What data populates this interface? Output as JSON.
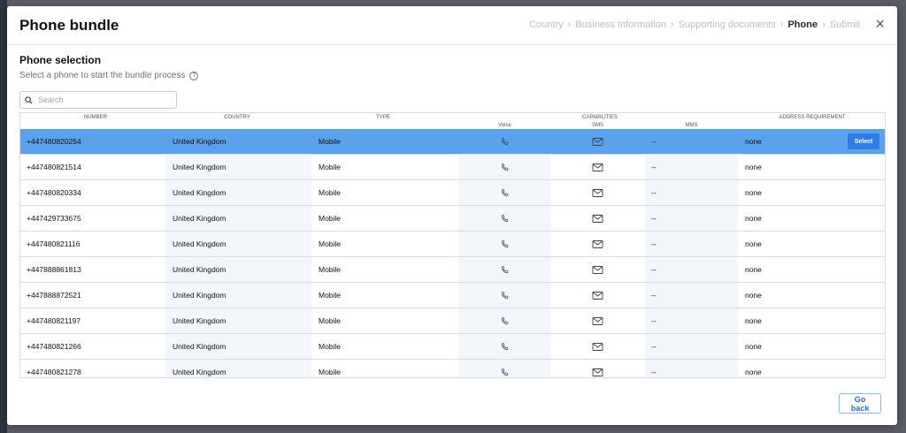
{
  "modal": {
    "title": "Phone bundle",
    "close_icon": "×"
  },
  "breadcrumb": [
    {
      "label": "Country",
      "active": false
    },
    {
      "label": "Business Information",
      "active": false
    },
    {
      "label": "Supporting documents",
      "active": false
    },
    {
      "label": "Phone",
      "active": true
    },
    {
      "label": "Submit",
      "active": false
    }
  ],
  "section": {
    "title": "Phone selection",
    "subtitle": "Select a phone to start the bundle process",
    "help_glyph": "?"
  },
  "search": {
    "placeholder": "Search",
    "value": ""
  },
  "table": {
    "headers": {
      "number": "NUMBER",
      "country": "COUNTRY",
      "type": "TYPE",
      "capabilities": "CAPABILITIES",
      "voice": "Voice",
      "sms": "SMS",
      "mms": "MMS",
      "address": "ADDRESS REQUIREMENT"
    },
    "rows": [
      {
        "number": "+447480820254",
        "country": "United Kingdom",
        "type": "Mobile",
        "mms": "--",
        "address": "none",
        "selected": true
      },
      {
        "number": "+447480821514",
        "country": "United Kingdom",
        "type": "Mobile",
        "mms": "--",
        "address": "none",
        "selected": false
      },
      {
        "number": "+447480820334",
        "country": "United Kingdom",
        "type": "Mobile",
        "mms": "--",
        "address": "none",
        "selected": false
      },
      {
        "number": "+447429733675",
        "country": "United Kingdom",
        "type": "Mobile",
        "mms": "--",
        "address": "none",
        "selected": false
      },
      {
        "number": "+447480821116",
        "country": "United Kingdom",
        "type": "Mobile",
        "mms": "--",
        "address": "none",
        "selected": false
      },
      {
        "number": "+447888861813",
        "country": "United Kingdom",
        "type": "Mobile",
        "mms": "--",
        "address": "none",
        "selected": false
      },
      {
        "number": "+447888872521",
        "country": "United Kingdom",
        "type": "Mobile",
        "mms": "--",
        "address": "none",
        "selected": false
      },
      {
        "number": "+447480821197",
        "country": "United Kingdom",
        "type": "Mobile",
        "mms": "--",
        "address": "none",
        "selected": false
      },
      {
        "number": "+447480821266",
        "country": "United Kingdom",
        "type": "Mobile",
        "mms": "--",
        "address": "none",
        "selected": false
      },
      {
        "number": "+447480821278",
        "country": "United Kingdom",
        "type": "Mobile",
        "mms": "--",
        "address": "none",
        "selected": false
      }
    ],
    "select_label": "Select"
  },
  "footer": {
    "go_back_label": "Go back"
  },
  "colors": {
    "selected_row": "#5aa2ec",
    "select_button": "#2f7be8",
    "accent": "#2f6fd6"
  },
  "icons": {
    "voice": "phone-icon",
    "sms": "envelope-icon",
    "search": "search-icon",
    "close": "close-icon",
    "help": "help-circle-icon"
  }
}
